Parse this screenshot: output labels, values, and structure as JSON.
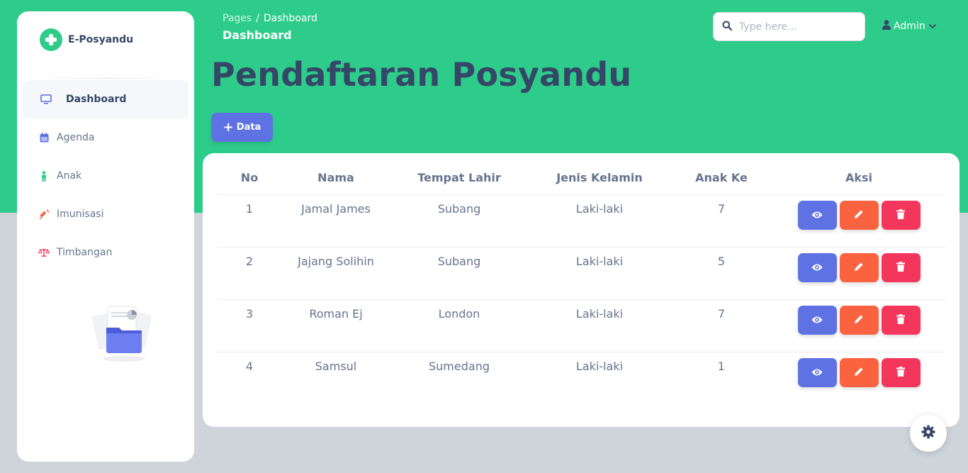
{
  "app": {
    "brand_name": "E-Posyandu"
  },
  "sidebar": {
    "items": [
      {
        "label": "Dashboard",
        "icon": "monitor-icon",
        "active": true
      },
      {
        "label": "Agenda",
        "icon": "calendar-icon"
      },
      {
        "label": "Anak",
        "icon": "child-icon"
      },
      {
        "label": "Imunisasi",
        "icon": "syringe-icon"
      },
      {
        "label": "Timbangan",
        "icon": "scale-icon"
      }
    ]
  },
  "header": {
    "breadcrumb_root": "Pages",
    "breadcrumb_separator": "/",
    "breadcrumb_current": "Dashboard",
    "title": "Dashboard",
    "search_placeholder": "Type here...",
    "user_label": "Admin"
  },
  "main": {
    "page_title": "Pendaftaran Posyandu",
    "add_button_label": "Data",
    "table": {
      "columns": [
        "No",
        "Nama",
        "Tempat Lahir",
        "Jenis Kelamin",
        "Anak Ke",
        "Aksi"
      ],
      "rows": [
        {
          "no": "1",
          "nama": "Jamal James",
          "tempat_lahir": "Subang",
          "jenis_kelamin": "Laki-laki",
          "anak_ke": "7"
        },
        {
          "no": "2",
          "nama": "Jajang Solihin",
          "tempat_lahir": "Subang",
          "jenis_kelamin": "Laki-laki",
          "anak_ke": "5"
        },
        {
          "no": "3",
          "nama": "Roman Ej",
          "tempat_lahir": "London",
          "jenis_kelamin": "Laki-laki",
          "anak_ke": "7"
        },
        {
          "no": "4",
          "nama": "Samsul",
          "tempat_lahir": "Sumedang",
          "jenis_kelamin": "Laki-laki",
          "anak_ke": "1"
        }
      ]
    }
  },
  "colors": {
    "brand_green": "#2ecc8a",
    "primary": "#5e72e4",
    "warning": "#fb6340",
    "danger": "#f5365c",
    "heading": "#344767"
  }
}
